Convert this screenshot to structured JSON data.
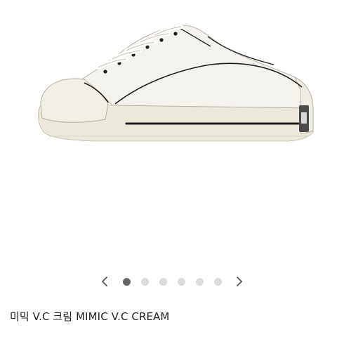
{
  "product": {
    "name": "미믹 V.C 크림 MIMIC V.C CREAM",
    "image_icon": "sneaker-image",
    "colors": {
      "upper": "#f4f2ec",
      "sole": "#ece8dc",
      "stitch": "#1e1e1e",
      "label": "#4a4a4a"
    }
  },
  "carousel": {
    "prev_icon": "chevron-left-icon",
    "next_icon": "chevron-right-icon",
    "slide_count": 6,
    "active_index": 0,
    "active_color": "#666666",
    "inactive_color": "#dcdcdc"
  }
}
